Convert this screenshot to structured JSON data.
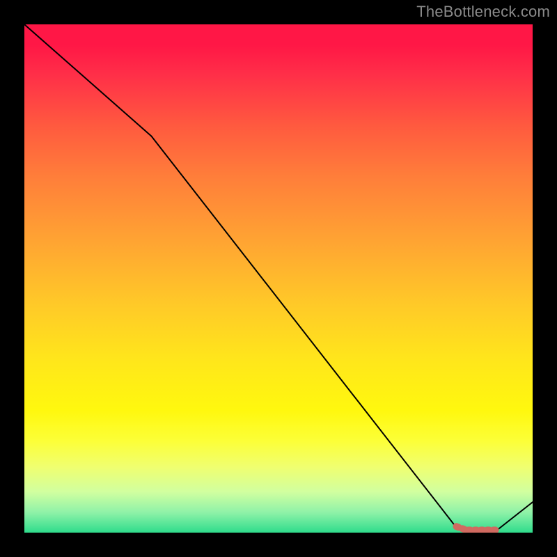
{
  "watermark": "TheBottleneck.com",
  "chart_data": {
    "type": "line",
    "title": "",
    "xlabel": "",
    "ylabel": "",
    "xlim": [
      0,
      100
    ],
    "ylim": [
      0,
      100
    ],
    "series": [
      {
        "name": "bottleneck-curve",
        "x": [
          0,
          25,
          85,
          93,
          100
        ],
        "y": [
          100,
          78,
          1,
          0.5,
          6
        ],
        "color": "#000000",
        "width": 2
      },
      {
        "name": "optimal-region",
        "x": [
          85,
          87,
          93
        ],
        "y": [
          1.2,
          0.5,
          0.5
        ],
        "color": "#d06a60",
        "width": 10,
        "dash": [
          3,
          6
        ]
      }
    ],
    "gradient_stops": [
      {
        "pos": 0,
        "color": "#ff1746"
      },
      {
        "pos": 50,
        "color": "#ffc928"
      },
      {
        "pos": 80,
        "color": "#fff80e"
      },
      {
        "pos": 100,
        "color": "#2fdc8c"
      }
    ]
  }
}
